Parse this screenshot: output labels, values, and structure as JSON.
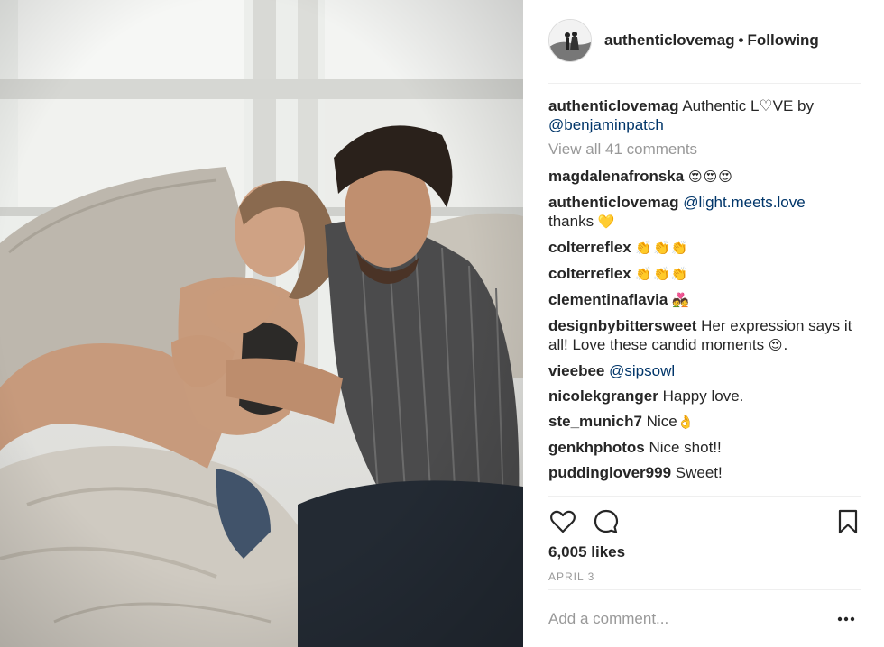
{
  "post": {
    "username": "authenticlovemag",
    "separator": "•",
    "follow_status": "Following",
    "caption_user": "authenticlovemag",
    "caption_text": "Authentic L♡VE by",
    "caption_mention": "@benjaminpatch",
    "view_all_label": "View all 41 comments",
    "likes_label": "6,005 likes",
    "date_label": "APRIL 3",
    "add_comment_placeholder": "Add a comment..."
  },
  "comments": [
    {
      "user": "magdalenafronska",
      "text": "",
      "emoji": "😍😍😍"
    },
    {
      "user": "authenticlovemag",
      "mention": "@light.meets.love",
      "text": "thanks",
      "emoji": "💛"
    },
    {
      "user": "colterreflex",
      "text": "",
      "emoji": "👏👏👏"
    },
    {
      "user": "colterreflex",
      "text": "",
      "emoji": "👏👏👏"
    },
    {
      "user": "clementinaflavia",
      "text": "",
      "emoji": "💑"
    },
    {
      "user": "designbybittersweet",
      "text": "Her expression says it all! Love these candid moments",
      "emoji": "😍",
      "trail": "."
    },
    {
      "user": "vieebee",
      "mention": "@sipsowl",
      "text": "",
      "emoji": ""
    },
    {
      "user": "nicolekgranger",
      "text": "Happy love.",
      "emoji": ""
    },
    {
      "user": "ste_munich7",
      "text": "Nice",
      "emoji": "👌"
    },
    {
      "user": "genkhphotos",
      "text": "Nice shot!!",
      "emoji": ""
    },
    {
      "user": "puddinglover999",
      "text": "Sweet!",
      "emoji": ""
    }
  ],
  "icons": [
    "heart-icon",
    "comment-icon",
    "bookmark-icon",
    "more-options-icon"
  ],
  "colors": {
    "link": "#003569",
    "muted": "#999999",
    "text": "#262626",
    "divider": "#efefef"
  }
}
